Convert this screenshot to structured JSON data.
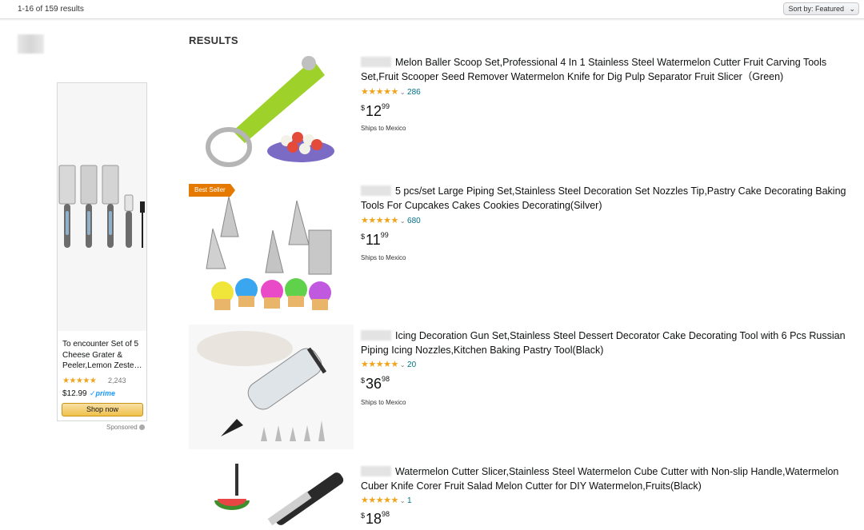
{
  "header": {
    "result_count": "1-16 of 159 results",
    "sort_label": "Sort by: Featured"
  },
  "sidebar_ad": {
    "title": "To encounter Set of 5 Cheese Grater & Peeler,Lemon Zeste…",
    "rating": "★★★★★",
    "review_count": "2,243",
    "price": "$12.99",
    "prime": "✓prime",
    "button_label": "Shop now",
    "sponsored": "Sponsored"
  },
  "results_heading": "RESULTS",
  "results": [
    {
      "title": "Melon Baller Scoop Set,Professional 4 In 1 Stainless Steel Watermelon Cutter Fruit Carving Tools Set,Fruit Scooper Seed Remover Watermelon Knife for Dig Pulp Separator Fruit Slicer（Green)",
      "stars": "★★★★★",
      "review_count": "286",
      "price_currency": "$",
      "price_whole": "12",
      "price_fraction": "99",
      "shipping": "Ships to Mexico",
      "badge": ""
    },
    {
      "title": "5 pcs/set Large Piping Set,Stainless Steel Decoration Set Nozzles Tip,Pastry Cake Decorating Baking Tools For Cupcakes Cakes Cookies Decorating(Silver)",
      "stars": "★★★★★",
      "review_count": "680",
      "price_currency": "$",
      "price_whole": "11",
      "price_fraction": "99",
      "shipping": "Ships to Mexico",
      "badge": "Best Seller"
    },
    {
      "title": "Icing Decoration Gun Set,Stainless Steel Dessert Decorator Cake Decorating Tool with 6 Pcs Russian Piping Icing Nozzles,Kitchen Baking Pastry Tool(Black)",
      "stars": "★★★★★",
      "review_count": "20",
      "price_currency": "$",
      "price_whole": "36",
      "price_fraction": "98",
      "shipping": "Ships to Mexico",
      "badge": ""
    },
    {
      "title": "Watermelon Cutter Slicer,Stainless Steel Watermelon Cube Cutter with Non-slip Handle,Watermelon Cuber Knife Corer Fruit Salad Melon Cutter for DIY Watermelon,Fruits(Black)",
      "stars": "★★★★★",
      "review_count": "1",
      "price_currency": "$",
      "price_whole": "18",
      "price_fraction": "98",
      "shipping": "",
      "badge": ""
    }
  ],
  "colors": {
    "star": "#f0a41c",
    "link": "#007185",
    "badge": "#e67a00",
    "button": "#f0c14b"
  }
}
